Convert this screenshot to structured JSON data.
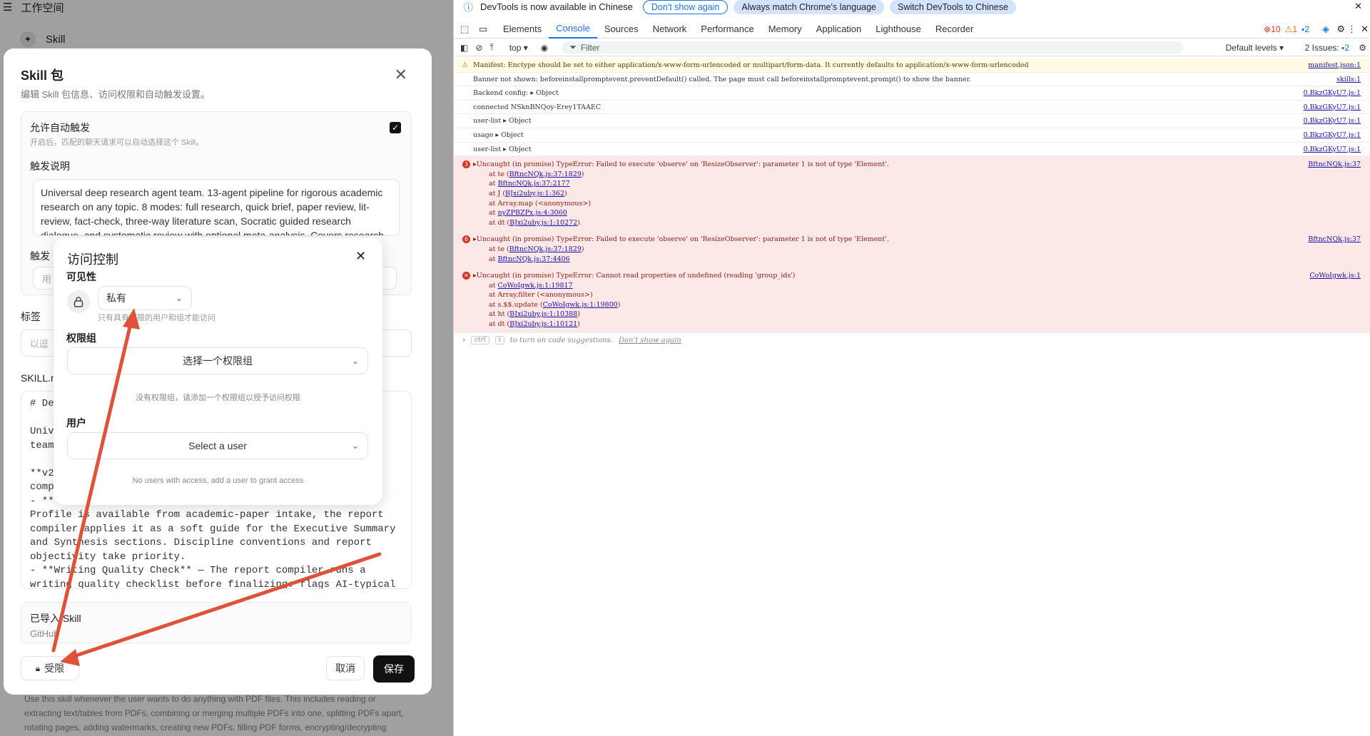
{
  "app": {
    "topbar": {
      "menu_icon": "menu-icon",
      "title": "工作空间"
    },
    "bg_skill_label": "Skill",
    "bg_bottom_text": "Use this skill whenever the user wants to do anything with PDF files. This includes reading or extracting text/tables from PDFs, combining or merging multiple PDFs into one, splitting PDFs apart, rotating pages, adding watermarks, creating new PDFs, filling PDF forms, encrypting/decrypting PDFs, extracting images..."
  },
  "skill_dialog": {
    "title": "Skill 包",
    "subtitle": "编辑 Skill 包信息、访问权限和自动触发设置。",
    "auto_trigger": {
      "label": "允许自动触发",
      "hint": "开启后，匹配的聊天请求可以自动选择这个 Skill。",
      "checked": true,
      "trigger_desc_label": "触发说明",
      "trigger_desc_value": "Universal deep research agent team. 13-agent pipeline for rigorous academic research on any topic. 8 modes: full research, quick brief, paper review, lit-review, fact-check, three-way literature scan, Socratic guided research dialogue, and systematic review with optional meta-analysis. Covers research question",
      "trigger2_label": "触发",
      "trigger2_placeholder": "用"
    },
    "tags_label": "标签",
    "tags_placeholder": "以逗",
    "skill_md_label": "SKILL.m",
    "skill_md_lines": [
      "# De",
      "",
      "Univ",
      "team",
      "",
      "**v2",
      "comp",
      "- **",
      "Profile is available from academic-paper intake, the report",
      "compiler applies it as a soft guide for the Executive Summary",
      "and Synthesis sections. Discipline conventions and report",
      "objectivity take priority.",
      "- **Writing Quality Check** — The report compiler runs a",
      "writing quality checklist before finalizing: flags AI-typical"
    ],
    "imported_label": "已导入 Skill",
    "imported_source": "GitHub",
    "access_button": "受限",
    "cancel_button": "取消",
    "save_button": "保存"
  },
  "access_dialog": {
    "title": "访问控制",
    "visibility_label": "可见性",
    "visibility_value": "私有",
    "visibility_hint": "只有具有权限的用户和组才能访问",
    "groups_label": "权限组",
    "groups_placeholder": "选择一个权限组",
    "groups_empty": "没有权限组，请添加一个权限组以授予访问权限",
    "users_label": "用户",
    "users_placeholder": "Select a user",
    "users_empty": "No users with access, add a user to grant access"
  },
  "annotation": {
    "arrow_color": "#e0513a"
  },
  "devtools": {
    "banner": {
      "text": "DevTools is now available in Chinese",
      "btn_dont_show": "Don't show again",
      "btn_match": "Always match Chrome's language",
      "btn_switch": "Switch DevTools to Chinese"
    },
    "tabs": [
      "Elements",
      "Console",
      "Sources",
      "Network",
      "Performance",
      "Memory",
      "Application",
      "Lighthouse",
      "Recorder"
    ],
    "active_tab": "Console",
    "counts": {
      "errors": "10",
      "warnings": "1",
      "messages": "2"
    },
    "toolbar": {
      "context": "top",
      "filter_placeholder": "Filter",
      "levels": "Default levels",
      "issues_label": "2 Issues:",
      "issues_count": "2"
    },
    "logs": [
      {
        "type": "warn",
        "text": "Manifest: Enctype should be set to either application/x-www-form-urlencoded or multipart/form-data. It currently defaults to application/x-www-form-urlencoded",
        "src": "manifest.json:1"
      },
      {
        "type": "info",
        "text": "Banner not shown: beforeinstallpromptevent.preventDefault() called. The page must call beforeinstallpromptevent.prompt() to show the banner.",
        "src": "skills:1"
      },
      {
        "type": "info",
        "text": "Backend config:  ▸ Object",
        "src": "0.BkzGKyU7.js:1"
      },
      {
        "type": "info",
        "text": "connected NSknBNQoy-Erey1TAAEC",
        "src": "0.BkzGKyU7.js:1"
      },
      {
        "type": "info",
        "text": "user-list  ▸ Object",
        "src": "0.BkzGKyU7.js:1"
      },
      {
        "type": "info",
        "text": "usage  ▸ Object",
        "src": "0.BkzGKyU7.js:1"
      },
      {
        "type": "info",
        "text": "user-list  ▸ Object",
        "src": "0.BkzGKyU7.js:1"
      }
    ],
    "errors": [
      {
        "count": "3",
        "message": "▸Uncaught (in promise) TypeError: Failed to execute 'observe' on 'ResizeObserver': parameter 1 is not of type 'Element'.",
        "src": "BftncNQk.js:37",
        "trace": [
          [
            "at te (",
            "BftncNQk.js:37:1829",
            ")"
          ],
          [
            "at ",
            "BftncNQk.js:37:2177",
            ""
          ],
          [
            "at J (",
            "BJxi2uby.js:1:362",
            ")"
          ],
          [
            "at Array.map (<anonymous>)",
            "",
            ""
          ],
          [
            "at ",
            "nyZPBZPx.js:4:3060",
            ""
          ],
          [
            "at dt (",
            "BJxi2uby.js:1:10272",
            ")"
          ]
        ]
      },
      {
        "count": "6",
        "message": "▸Uncaught (in promise) TypeError: Failed to execute 'observe' on 'ResizeObserver': parameter 1 is not of type 'Element'.",
        "src": "BftncNQk.js:37",
        "trace": [
          [
            "at te (",
            "BftncNQk.js:37:1829",
            ")"
          ],
          [
            "at ",
            "BftncNQk.js:37:4406",
            ""
          ]
        ]
      },
      {
        "count": "✕",
        "message": "▸Uncaught (in promise) TypeError: Cannot read properties of undefined (reading 'group_ids')",
        "src": "CoWoIgwk.js:1",
        "trace": [
          [
            "at ",
            "CoWoIgwk.js:1:19817",
            ""
          ],
          [
            "at Array.filter (<anonymous>)",
            "",
            ""
          ],
          [
            "at s.$$.update (",
            "CoWoIgwk.js:1:19800",
            ")"
          ],
          [
            "at ht (",
            "BJxi2uby.js:1:10388",
            ")"
          ],
          [
            "at dt (",
            "BJxi2uby.js:1:10121",
            ")"
          ]
        ]
      }
    ],
    "prompt": {
      "kbd1": "ctrl",
      "kbd2": "i",
      "text": "to turn on code suggestions.",
      "dont_show": "Don't show again"
    }
  }
}
